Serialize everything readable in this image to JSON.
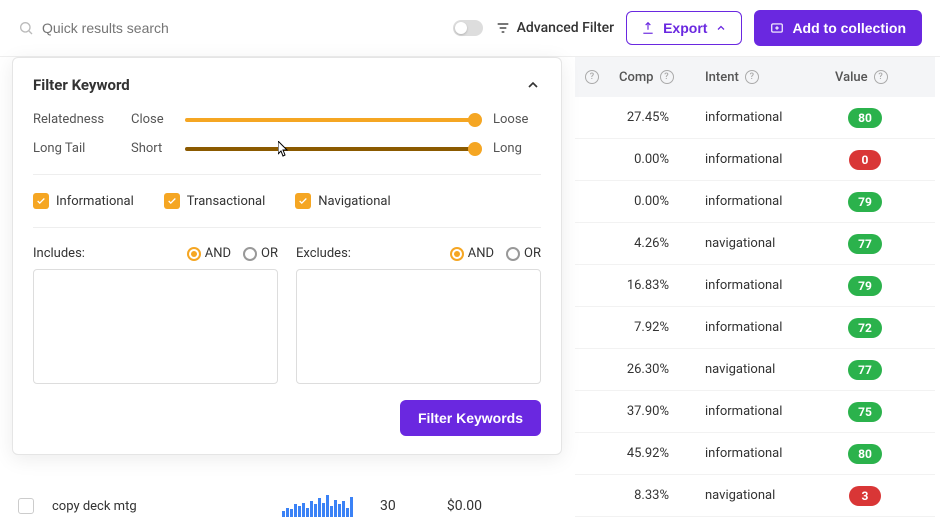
{
  "topbar": {
    "search_placeholder": "Quick results search",
    "advanced_filter": "Advanced Filter",
    "export": "Export",
    "add_collection": "Add to collection"
  },
  "panel": {
    "title": "Filter Keyword",
    "sliders": [
      {
        "label": "Relatedness",
        "min": "Close",
        "max": "Loose"
      },
      {
        "label": "Long Tail",
        "min": "Short",
        "max": "Long"
      }
    ],
    "intents": [
      "Informational",
      "Transactional",
      "Navigational"
    ],
    "includes_label": "Includes:",
    "excludes_label": "Excludes:",
    "and": "AND",
    "or": "OR",
    "filter_button": "Filter Keywords"
  },
  "table": {
    "headers": {
      "comp": "Comp",
      "intent": "Intent",
      "value": "Value"
    },
    "rows": [
      {
        "comp": "27.45%",
        "intent": "informational",
        "value": "80",
        "color": "green"
      },
      {
        "comp": "0.00%",
        "intent": "informational",
        "value": "0",
        "color": "red"
      },
      {
        "comp": "0.00%",
        "intent": "informational",
        "value": "79",
        "color": "green"
      },
      {
        "comp": "4.26%",
        "intent": "navigational",
        "value": "77",
        "color": "green"
      },
      {
        "comp": "16.83%",
        "intent": "informational",
        "value": "79",
        "color": "green"
      },
      {
        "comp": "7.92%",
        "intent": "informational",
        "value": "72",
        "color": "green"
      },
      {
        "comp": "26.30%",
        "intent": "navigational",
        "value": "77",
        "color": "green"
      },
      {
        "comp": "37.90%",
        "intent": "informational",
        "value": "75",
        "color": "green"
      },
      {
        "comp": "45.92%",
        "intent": "informational",
        "value": "80",
        "color": "green"
      },
      {
        "comp": "8.33%",
        "intent": "navigational",
        "value": "3",
        "color": "red"
      }
    ]
  },
  "bottom_row": {
    "keyword": "copy deck mtg",
    "volume": "30",
    "cpc": "$0.00",
    "spark": [
      4,
      6,
      5,
      8,
      7,
      9,
      6,
      10,
      8,
      12,
      9,
      14,
      7,
      11,
      8,
      10,
      6,
      13
    ]
  }
}
